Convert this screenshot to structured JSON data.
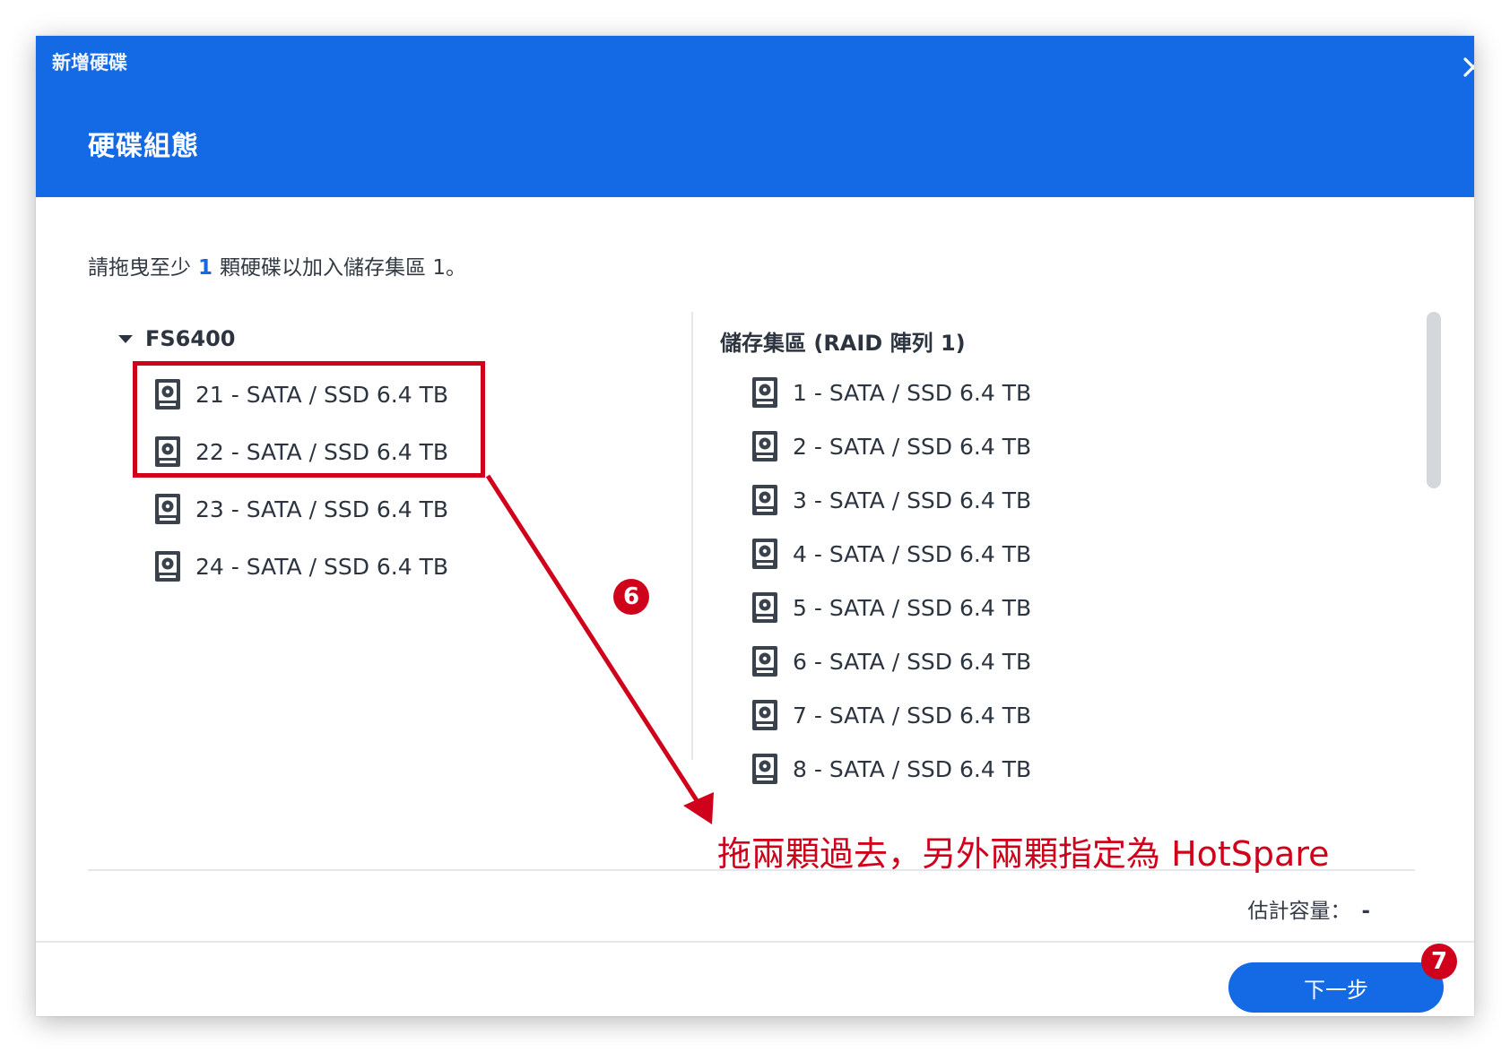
{
  "window": {
    "title": "新增硬碟",
    "close_icon": "close-icon"
  },
  "step": {
    "title": "硬碟組態"
  },
  "instruction": {
    "before": "請拖曳至少",
    "count": "1",
    "after": "顆硬碟以加入儲存集區 1。"
  },
  "left_pane": {
    "group_label": "FS6400",
    "disks": [
      {
        "label": "21 - SATA / SSD 6.4 TB"
      },
      {
        "label": "22 - SATA / SSD 6.4 TB"
      },
      {
        "label": "23 - SATA / SSD 6.4 TB"
      },
      {
        "label": "24 - SATA / SSD 6.4 TB"
      }
    ]
  },
  "right_pane": {
    "title": "儲存集區 (RAID 陣列 1)",
    "disks": [
      {
        "label": "1 - SATA / SSD 6.4 TB"
      },
      {
        "label": "2 - SATA / SSD 6.4 TB"
      },
      {
        "label": "3 - SATA / SSD 6.4 TB"
      },
      {
        "label": "4 - SATA / SSD 6.4 TB"
      },
      {
        "label": "5 - SATA / SSD 6.4 TB"
      },
      {
        "label": "6 - SATA / SSD 6.4 TB"
      },
      {
        "label": "7 - SATA / SSD 6.4 TB"
      },
      {
        "label": "8 - SATA / SSD 6.4 TB"
      }
    ]
  },
  "capacity": {
    "label": "估計容量：",
    "value": "-"
  },
  "footer": {
    "next_label": "下一步"
  },
  "annotations": {
    "badge_6": "6",
    "badge_7": "7",
    "note": "拖兩顆過去，另外兩顆指定為 HotSpare"
  },
  "colors": {
    "header": "#1469e5",
    "accent": "#1469e5",
    "annotation": "#d0021b"
  }
}
